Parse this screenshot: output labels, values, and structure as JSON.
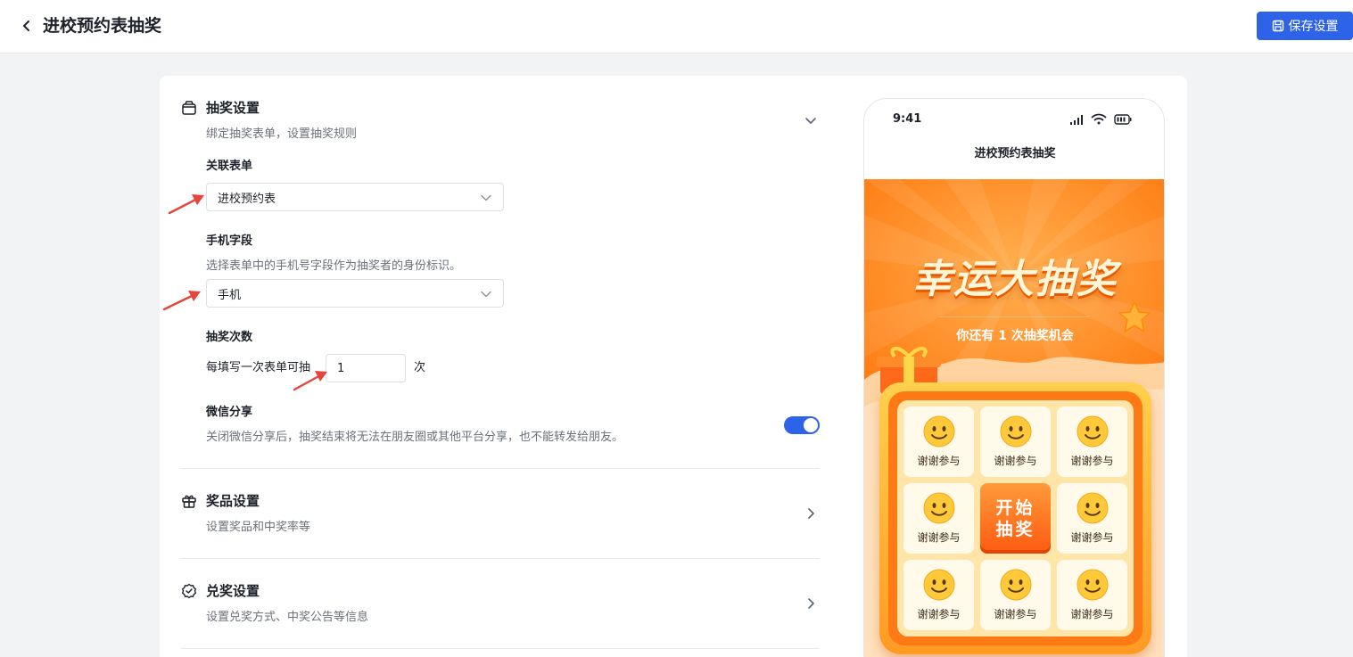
{
  "header": {
    "title": "进校预约表抽奖",
    "save_label": "保存设置"
  },
  "lottery_settings": {
    "title": "抽奖设置",
    "desc": "绑定抽奖表单，设置抽奖规则",
    "form_field": {
      "label": "关联表单",
      "value": "进校预约表"
    },
    "phone_field": {
      "label": "手机字段",
      "help": "选择表单中的手机号字段作为抽奖者的身份标识。",
      "value": "手机"
    },
    "draw_count": {
      "label": "抽奖次数",
      "prefix": "每填写一次表单可抽",
      "value": "1",
      "suffix": "次"
    },
    "wechat_share": {
      "label": "微信分享",
      "help": "关闭微信分享后，抽奖结束将无法在朋友圈或其他平台分享，也不能转发给朋友。",
      "enabled": true
    }
  },
  "prize_settings": {
    "title": "奖品设置",
    "desc": "设置奖品和中奖率等"
  },
  "redeem_settings": {
    "title": "兑奖设置",
    "desc": "设置兑奖方式、中奖公告等信息"
  },
  "preview": {
    "time": "9:41",
    "title": "进校预约表抽奖",
    "headline": "幸运大抽奖",
    "chance_text": "你还有 1 次抽奖机会",
    "cells": [
      "谢谢参与",
      "谢谢参与",
      "谢谢参与",
      "谢谢参与",
      "谢谢参与",
      "谢谢参与",
      "谢谢参与",
      "谢谢参与"
    ],
    "start_label": "开始抽奖"
  },
  "colors": {
    "primary": "#2d63e8",
    "banner": "#ff8a1e",
    "accent_red": "#e5453a"
  }
}
